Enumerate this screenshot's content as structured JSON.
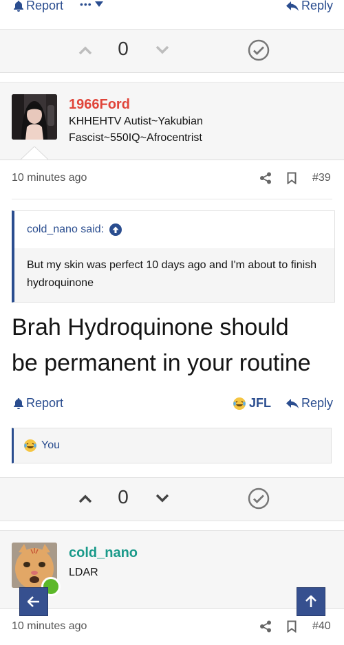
{
  "top_actions": {
    "report": "Report",
    "more": "•••",
    "reply": "Reply"
  },
  "vote1": {
    "count": "0"
  },
  "post39": {
    "username": "1966Ford",
    "title_line1": "KHHEHTV Autist~Yakubian",
    "title_line2": "Fascist~550IQ~Afrocentrist",
    "time": "10 minutes ago",
    "number": "#39",
    "quote_author": "cold_nano said:",
    "quote_text": "But my skin was perfect 10 days ago and I'm about to finish hydroquinone",
    "text_line1": "Brah Hydroquinone should",
    "text_line2": "be permanent in your routine",
    "report": "Report",
    "jfl": "JFL",
    "reply": "Reply",
    "reaction_user": "You"
  },
  "vote2": {
    "count": "0"
  },
  "post40": {
    "username": "cold_nano",
    "title": "LDAR",
    "time": "10 minutes ago",
    "number": "#40"
  },
  "colors": {
    "accent": "#2a4d8f",
    "username_red": "#e0453a",
    "username_teal": "#1a9a8a",
    "online": "#5cb82a"
  },
  "icons": [
    "bell-icon",
    "reply-icon",
    "share-icon",
    "bookmark-icon",
    "up-arrow-circle-icon",
    "check-circle-icon",
    "chevron-up-icon",
    "chevron-down-icon",
    "laugh-cry-emoji-icon",
    "arrow-left-icon",
    "arrow-up-icon"
  ]
}
